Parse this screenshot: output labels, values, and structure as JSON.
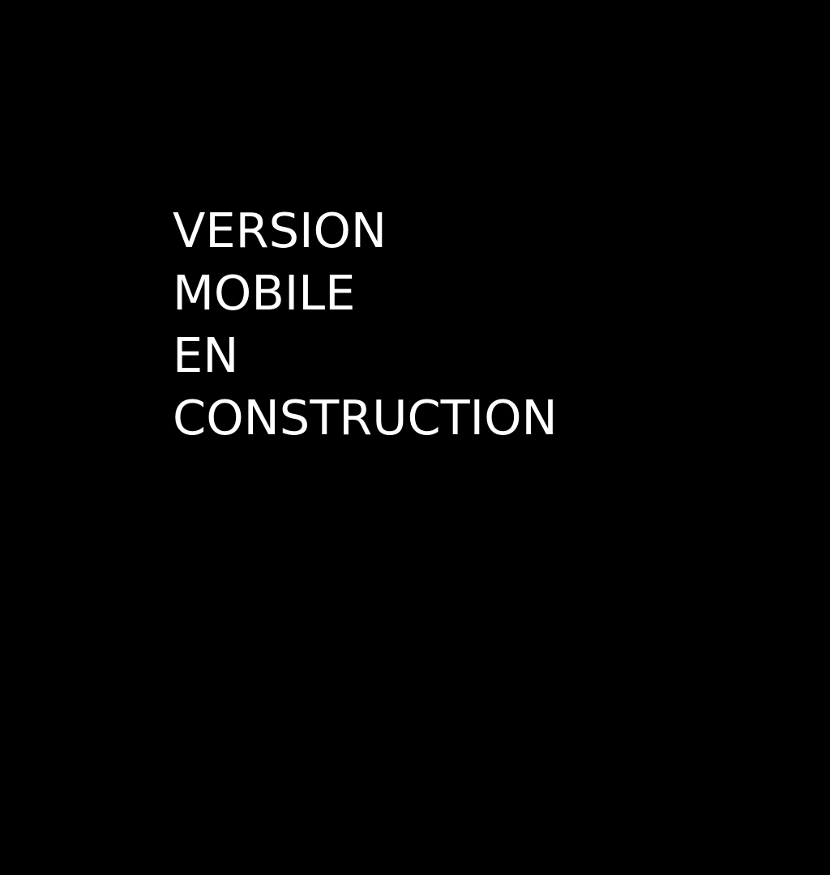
{
  "colors": {
    "background": "#000000",
    "text": "#ffffff"
  },
  "message": {
    "lines": [
      "VERSION",
      "MOBILE",
      "EN",
      "CONSTRUCTION"
    ]
  }
}
